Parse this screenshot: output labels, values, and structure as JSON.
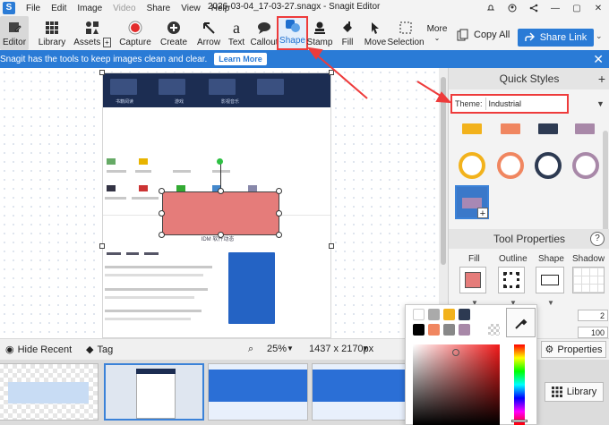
{
  "menu": {
    "items": [
      "File",
      "Edit",
      "Image",
      "Video",
      "Share",
      "View",
      "Help"
    ],
    "disabled": "Video"
  },
  "window": {
    "title": "2026-03-04_17-03-27.snagx - Snagit Editor"
  },
  "toolbar": {
    "editor": "Editor",
    "library": "Library",
    "assets": "Assets",
    "capture": "Capture",
    "create": "Create",
    "arrow": "Arrow",
    "text": "Text",
    "callout": "Callout",
    "shape": "Shape",
    "stamp": "Stamp",
    "fill": "Fill",
    "move": "Move",
    "selection": "Selection",
    "more": "More",
    "copy_all": "Copy All",
    "share_link": "Share Link"
  },
  "banner": {
    "text": "Snagit has the tools to keep images clean and clear.",
    "learn_more": "Learn More"
  },
  "document": {
    "strip_captions": [
      "书籍阅读",
      "游戏",
      "影视音乐"
    ],
    "section_title": "IDM 软件动态"
  },
  "quick_styles": {
    "title": "Quick Styles",
    "theme_label": "Theme:",
    "theme_value": "Industrial",
    "rect_swatches": [
      "#f2b21c",
      "#f08660",
      "#2d3a52",
      "#a888a8"
    ],
    "ring_swatches": [
      "#f2b21c",
      "#f08660",
      "#2d3a52",
      "#a888a8"
    ]
  },
  "tool_properties": {
    "title": "Tool Properties",
    "fill": "Fill",
    "outline": "Outline",
    "shape": "Shape",
    "shadow": "Shadow",
    "fill_color": "#e57c7a",
    "field1": "2",
    "field2": "100"
  },
  "statusbar": {
    "hide_recent": "Hide Recent",
    "tag": "Tag",
    "zoom": "25%",
    "dimensions": "1437 x 2170px",
    "properties": "Properties"
  },
  "tray": {
    "library": "Library"
  },
  "color_picker": {
    "swatches": [
      "#ffffff",
      "#aaaaaa",
      "#f2b21c",
      "#2d3a52",
      "#000000",
      "#f08660",
      "#888888",
      "#a888a8"
    ]
  },
  "accent": {
    "blue": "#2a7bd6",
    "highlight_red": "#ee3b3b"
  }
}
